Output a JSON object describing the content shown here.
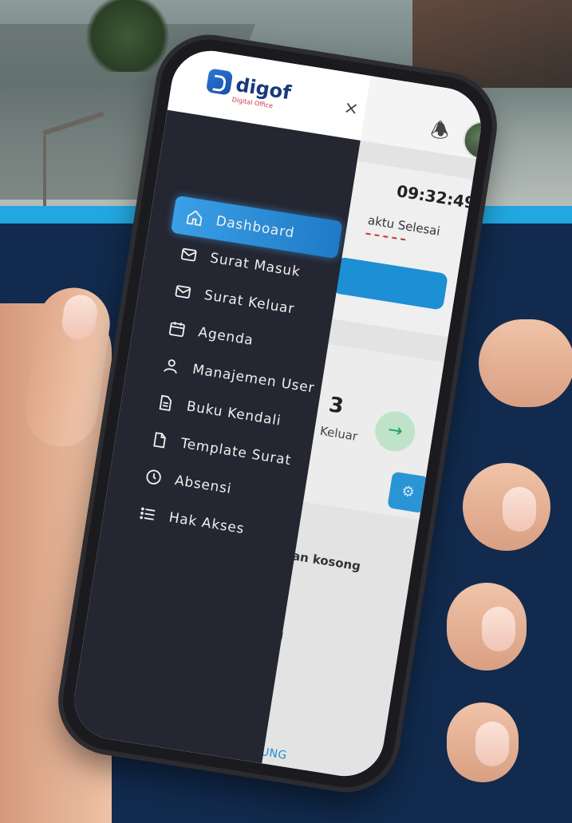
{
  "app": {
    "logo_text": "digof",
    "logo_subtitle": "Digital Office"
  },
  "drawer": {
    "close_symbol": "×",
    "items": [
      {
        "label": "Dashboard",
        "icon": "home-icon",
        "active": true
      },
      {
        "label": "Surat Masuk",
        "icon": "mail-icon"
      },
      {
        "label": "Surat Keluar",
        "icon": "mail-icon"
      },
      {
        "label": "Agenda",
        "icon": "calendar-icon"
      },
      {
        "label": "Manajemen User",
        "icon": "user-icon"
      },
      {
        "label": "Buku Kendali",
        "icon": "document-icon"
      },
      {
        "label": "Template Surat",
        "icon": "file-icon"
      },
      {
        "label": "Absensi",
        "icon": "clock-icon"
      },
      {
        "label": "Hak Akses",
        "icon": "list-icon"
      }
    ]
  },
  "dashboard": {
    "clock": "09:32:49",
    "waktu_label": "aktu Selesai",
    "count_partial": "3",
    "keluar_label": "Keluar",
    "empty_text": "kan kosong",
    "partial_text": "g",
    "footer_text": "B BADUNG"
  },
  "colors": {
    "accent": "#1f7ac7",
    "drawer_bg": "#242631",
    "background": "#112a4d",
    "stripe": "#22a7e0"
  }
}
